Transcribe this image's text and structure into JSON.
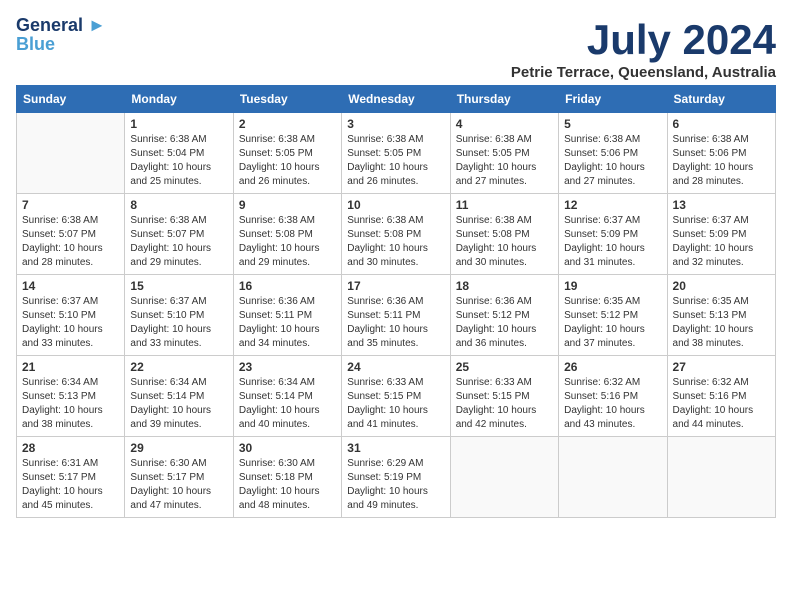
{
  "logo": {
    "line1": "General",
    "line2": "Blue"
  },
  "title": "July 2024",
  "location": "Petrie Terrace, Queensland, Australia",
  "weekdays": [
    "Sunday",
    "Monday",
    "Tuesday",
    "Wednesday",
    "Thursday",
    "Friday",
    "Saturday"
  ],
  "weeks": [
    [
      {
        "day": "",
        "sunrise": "",
        "sunset": "",
        "daylight": ""
      },
      {
        "day": "1",
        "sunrise": "Sunrise: 6:38 AM",
        "sunset": "Sunset: 5:04 PM",
        "daylight": "Daylight: 10 hours and 25 minutes."
      },
      {
        "day": "2",
        "sunrise": "Sunrise: 6:38 AM",
        "sunset": "Sunset: 5:05 PM",
        "daylight": "Daylight: 10 hours and 26 minutes."
      },
      {
        "day": "3",
        "sunrise": "Sunrise: 6:38 AM",
        "sunset": "Sunset: 5:05 PM",
        "daylight": "Daylight: 10 hours and 26 minutes."
      },
      {
        "day": "4",
        "sunrise": "Sunrise: 6:38 AM",
        "sunset": "Sunset: 5:05 PM",
        "daylight": "Daylight: 10 hours and 27 minutes."
      },
      {
        "day": "5",
        "sunrise": "Sunrise: 6:38 AM",
        "sunset": "Sunset: 5:06 PM",
        "daylight": "Daylight: 10 hours and 27 minutes."
      },
      {
        "day": "6",
        "sunrise": "Sunrise: 6:38 AM",
        "sunset": "Sunset: 5:06 PM",
        "daylight": "Daylight: 10 hours and 28 minutes."
      }
    ],
    [
      {
        "day": "7",
        "sunrise": "Sunrise: 6:38 AM",
        "sunset": "Sunset: 5:07 PM",
        "daylight": "Daylight: 10 hours and 28 minutes."
      },
      {
        "day": "8",
        "sunrise": "Sunrise: 6:38 AM",
        "sunset": "Sunset: 5:07 PM",
        "daylight": "Daylight: 10 hours and 29 minutes."
      },
      {
        "day": "9",
        "sunrise": "Sunrise: 6:38 AM",
        "sunset": "Sunset: 5:08 PM",
        "daylight": "Daylight: 10 hours and 29 minutes."
      },
      {
        "day": "10",
        "sunrise": "Sunrise: 6:38 AM",
        "sunset": "Sunset: 5:08 PM",
        "daylight": "Daylight: 10 hours and 30 minutes."
      },
      {
        "day": "11",
        "sunrise": "Sunrise: 6:38 AM",
        "sunset": "Sunset: 5:08 PM",
        "daylight": "Daylight: 10 hours and 30 minutes."
      },
      {
        "day": "12",
        "sunrise": "Sunrise: 6:37 AM",
        "sunset": "Sunset: 5:09 PM",
        "daylight": "Daylight: 10 hours and 31 minutes."
      },
      {
        "day": "13",
        "sunrise": "Sunrise: 6:37 AM",
        "sunset": "Sunset: 5:09 PM",
        "daylight": "Daylight: 10 hours and 32 minutes."
      }
    ],
    [
      {
        "day": "14",
        "sunrise": "Sunrise: 6:37 AM",
        "sunset": "Sunset: 5:10 PM",
        "daylight": "Daylight: 10 hours and 33 minutes."
      },
      {
        "day": "15",
        "sunrise": "Sunrise: 6:37 AM",
        "sunset": "Sunset: 5:10 PM",
        "daylight": "Daylight: 10 hours and 33 minutes."
      },
      {
        "day": "16",
        "sunrise": "Sunrise: 6:36 AM",
        "sunset": "Sunset: 5:11 PM",
        "daylight": "Daylight: 10 hours and 34 minutes."
      },
      {
        "day": "17",
        "sunrise": "Sunrise: 6:36 AM",
        "sunset": "Sunset: 5:11 PM",
        "daylight": "Daylight: 10 hours and 35 minutes."
      },
      {
        "day": "18",
        "sunrise": "Sunrise: 6:36 AM",
        "sunset": "Sunset: 5:12 PM",
        "daylight": "Daylight: 10 hours and 36 minutes."
      },
      {
        "day": "19",
        "sunrise": "Sunrise: 6:35 AM",
        "sunset": "Sunset: 5:12 PM",
        "daylight": "Daylight: 10 hours and 37 minutes."
      },
      {
        "day": "20",
        "sunrise": "Sunrise: 6:35 AM",
        "sunset": "Sunset: 5:13 PM",
        "daylight": "Daylight: 10 hours and 38 minutes."
      }
    ],
    [
      {
        "day": "21",
        "sunrise": "Sunrise: 6:34 AM",
        "sunset": "Sunset: 5:13 PM",
        "daylight": "Daylight: 10 hours and 38 minutes."
      },
      {
        "day": "22",
        "sunrise": "Sunrise: 6:34 AM",
        "sunset": "Sunset: 5:14 PM",
        "daylight": "Daylight: 10 hours and 39 minutes."
      },
      {
        "day": "23",
        "sunrise": "Sunrise: 6:34 AM",
        "sunset": "Sunset: 5:14 PM",
        "daylight": "Daylight: 10 hours and 40 minutes."
      },
      {
        "day": "24",
        "sunrise": "Sunrise: 6:33 AM",
        "sunset": "Sunset: 5:15 PM",
        "daylight": "Daylight: 10 hours and 41 minutes."
      },
      {
        "day": "25",
        "sunrise": "Sunrise: 6:33 AM",
        "sunset": "Sunset: 5:15 PM",
        "daylight": "Daylight: 10 hours and 42 minutes."
      },
      {
        "day": "26",
        "sunrise": "Sunrise: 6:32 AM",
        "sunset": "Sunset: 5:16 PM",
        "daylight": "Daylight: 10 hours and 43 minutes."
      },
      {
        "day": "27",
        "sunrise": "Sunrise: 6:32 AM",
        "sunset": "Sunset: 5:16 PM",
        "daylight": "Daylight: 10 hours and 44 minutes."
      }
    ],
    [
      {
        "day": "28",
        "sunrise": "Sunrise: 6:31 AM",
        "sunset": "Sunset: 5:17 PM",
        "daylight": "Daylight: 10 hours and 45 minutes."
      },
      {
        "day": "29",
        "sunrise": "Sunrise: 6:30 AM",
        "sunset": "Sunset: 5:17 PM",
        "daylight": "Daylight: 10 hours and 47 minutes."
      },
      {
        "day": "30",
        "sunrise": "Sunrise: 6:30 AM",
        "sunset": "Sunset: 5:18 PM",
        "daylight": "Daylight: 10 hours and 48 minutes."
      },
      {
        "day": "31",
        "sunrise": "Sunrise: 6:29 AM",
        "sunset": "Sunset: 5:19 PM",
        "daylight": "Daylight: 10 hours and 49 minutes."
      },
      {
        "day": "",
        "sunrise": "",
        "sunset": "",
        "daylight": ""
      },
      {
        "day": "",
        "sunrise": "",
        "sunset": "",
        "daylight": ""
      },
      {
        "day": "",
        "sunrise": "",
        "sunset": "",
        "daylight": ""
      }
    ]
  ]
}
